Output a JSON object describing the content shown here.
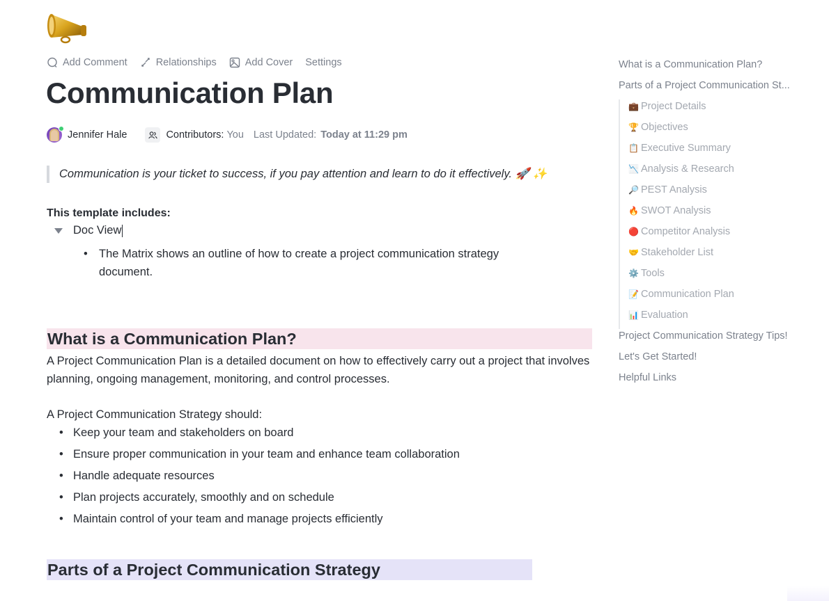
{
  "page": {
    "icon": "megaphone-icon",
    "title": "Communication Plan"
  },
  "actions": [
    {
      "label": "Add Comment",
      "icon": "comment-icon"
    },
    {
      "label": "Relationships",
      "icon": "relationships-icon"
    },
    {
      "label": "Add Cover",
      "icon": "image-icon"
    },
    {
      "label": "Settings"
    }
  ],
  "meta": {
    "author": "Jennifer Hale",
    "contributors_label": "Contributors:",
    "contributors_value": "You",
    "updated_label": "Last Updated:",
    "updated_value": "Today at 11:29 pm"
  },
  "quote": "Communication is your ticket to success, if you pay attention and learn to do it effectively. 🚀 ✨",
  "includes": {
    "heading": "This template includes:",
    "toggle_label": "Doc View",
    "nested_item": "The Matrix shows an outline of how to create a project communication strategy document."
  },
  "sections": {
    "what_heading": "What is a Communication Plan?",
    "what_paragraph": "A Project Communication Plan is a detailed document on how to effectively carry out a project that involves planning, ongoing management, monitoring, and control processes.",
    "should_intro": "A Project Communication Strategy should:",
    "should_items": [
      "Keep your team and stakeholders on board",
      "Ensure proper communication in your team and enhance team collaboration",
      "Handle adequate resources",
      "Plan projects accurately, smoothly and on schedule",
      "Maintain control of your team and manage projects efficiently"
    ],
    "parts_heading": "Parts of a Project Communication Strategy"
  },
  "colors": {
    "heading_what_bg": "#f8e4ec",
    "heading_parts_bg": "#e5e3f8",
    "muted_text": "#7c828d",
    "body_text": "#292d34"
  },
  "toc": {
    "top": [
      "What is a Communication Plan?",
      "Parts of a Project Communication St..."
    ],
    "sub": [
      {
        "emoji": "💼",
        "label": "Project Details"
      },
      {
        "emoji": "🏆",
        "label": "Objectives"
      },
      {
        "emoji": "📋",
        "label": "Executive Summary"
      },
      {
        "emoji": "📉",
        "label": "Analysis & Research"
      },
      {
        "emoji": "🔎",
        "label": "PEST Analysis"
      },
      {
        "emoji": "🔥",
        "label": "SWOT Analysis"
      },
      {
        "emoji": "🔴",
        "label": "Competitor Analysis"
      },
      {
        "emoji": "🤝",
        "label": "Stakeholder List"
      },
      {
        "emoji": "⚙️",
        "label": "Tools"
      },
      {
        "emoji": "📝",
        "label": "Communication Plan"
      },
      {
        "emoji": "📊",
        "label": "Evaluation"
      }
    ],
    "bottom": [
      "Project Communication Strategy Tips!",
      "Let's Get Started!",
      "Helpful Links"
    ]
  }
}
